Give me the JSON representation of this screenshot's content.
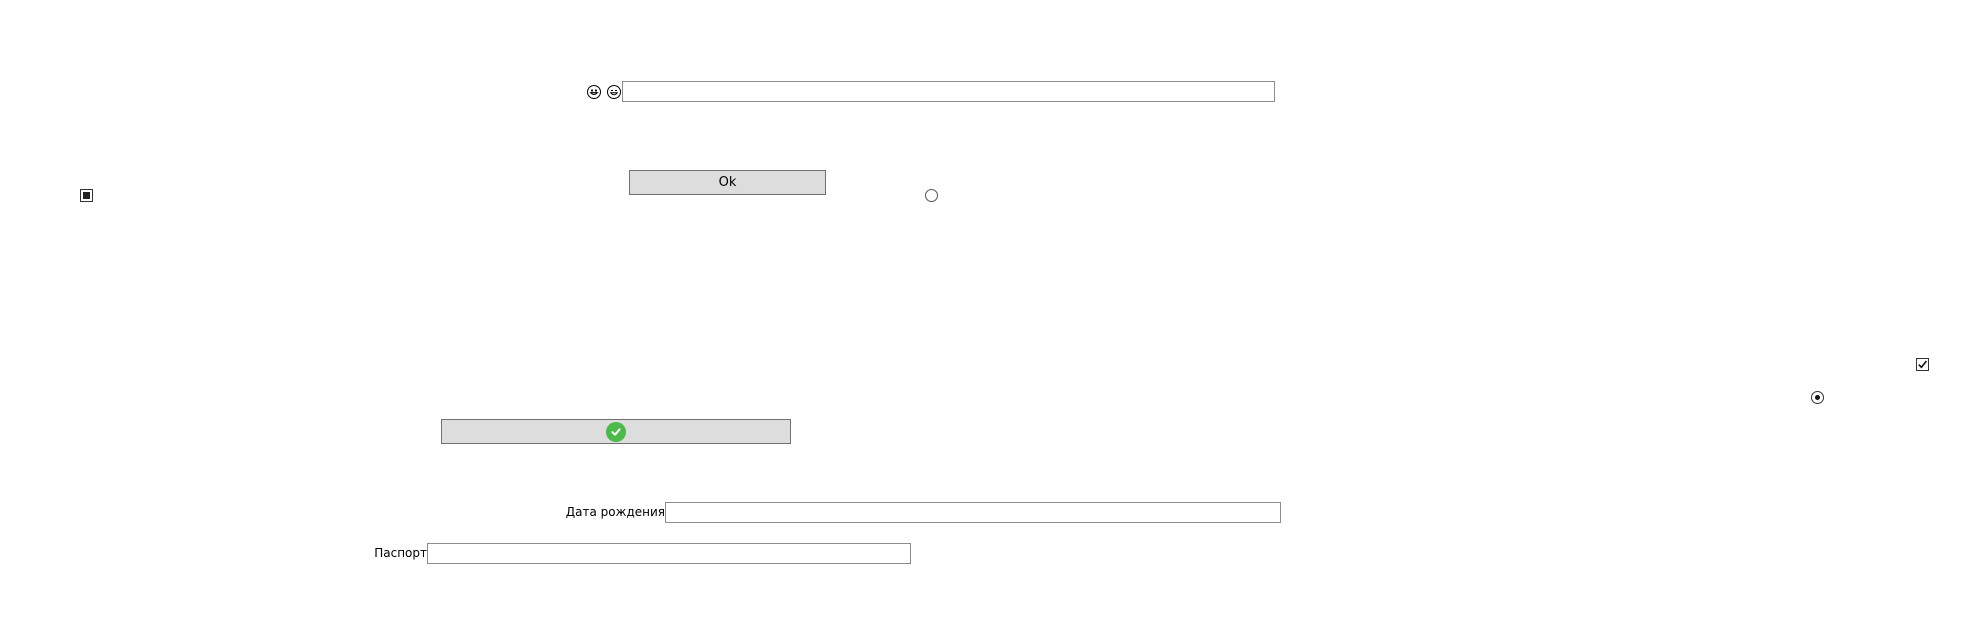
{
  "top_row": {
    "icon_1": "grinning-face-icon",
    "icon_2": "smiling-face-icon",
    "text_value": ""
  },
  "ok_button": {
    "label": "Ok"
  },
  "checkbox_left": {
    "state": "indeterminate"
  },
  "radio_middle": {
    "checked": false
  },
  "checkbox_right": {
    "checked": true
  },
  "radio_right": {
    "checked": true
  },
  "confirm_button": {
    "icon": "checkmark-circle-icon",
    "icon_color": "#4cba4a"
  },
  "birth_date": {
    "label": "Дата рождения",
    "value": ""
  },
  "passport": {
    "label": "Паспорт",
    "value": ""
  }
}
